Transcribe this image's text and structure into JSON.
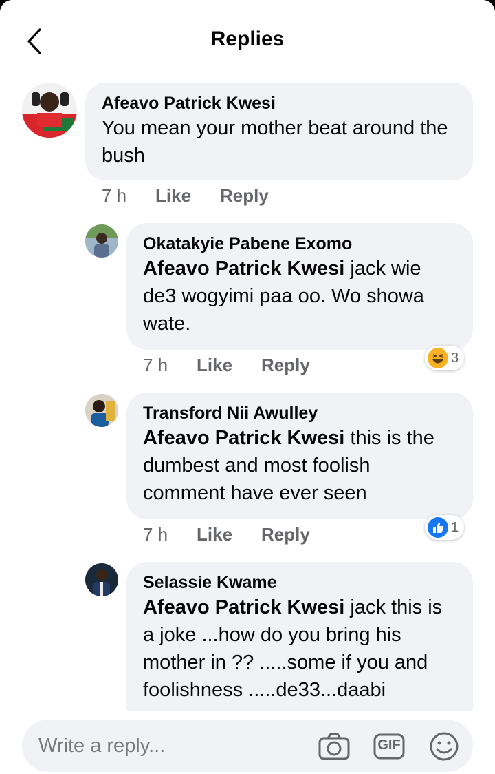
{
  "header": {
    "title": "Replies"
  },
  "parent_comment": {
    "author": "Afeavo Patrick Kwesi",
    "text": "You mean your mother beat around the bush",
    "time": "7 h",
    "like_label": "Like",
    "reply_label": "Reply"
  },
  "replies": [
    {
      "author": "Okatakyie Pabene Exomo",
      "mention": "Afeavo Patrick Kwesi",
      "text": " jack wie de3 wogyimi paa oo. Wo showa wate.",
      "time": "7 h",
      "like_label": "Like",
      "reply_label": "Reply",
      "reaction": {
        "icon": "haha-icon",
        "count": "3"
      }
    },
    {
      "author": "Transford Nii Awulley",
      "mention": "Afeavo Patrick Kwesi",
      "text": " this is the dumbest and most foolish comment have ever seen",
      "time": "7 h",
      "like_label": "Like",
      "reply_label": "Reply",
      "reaction": {
        "icon": "like-icon",
        "count": "1"
      }
    },
    {
      "author": "Selassie Kwame",
      "mention": "Afeavo Patrick Kwesi",
      "text": " jack this is a joke ...how do you bring his mother in ?? .....some if you and foolishness .....de33...daabi"
    }
  ],
  "composer": {
    "placeholder": "Write a reply...",
    "gif_label": "GIF"
  },
  "colors": {
    "bubble": "#f0f2f5",
    "meta": "#65676b",
    "like_blue": "#1877f2",
    "haha_yellow": "#f7b125"
  }
}
